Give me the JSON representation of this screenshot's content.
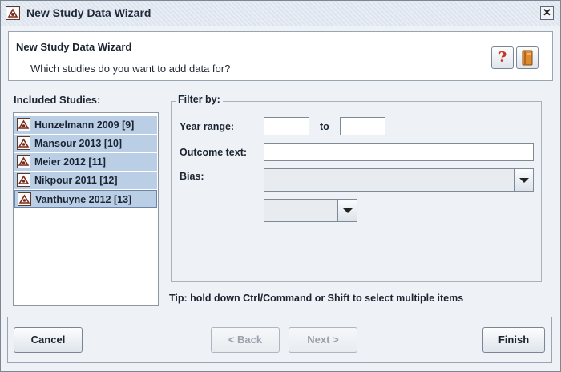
{
  "window": {
    "title": "New Study Data Wizard",
    "icon": "addis-app-icon",
    "close_icon": "close-icon"
  },
  "header": {
    "title": "New Study Data Wizard",
    "subtitle": "Which studies do you want to add data for?",
    "help_label": "?",
    "help_icon": "help-icon",
    "book_icon": "book-icon"
  },
  "studies": {
    "label": "Included Studies:",
    "items": [
      {
        "label": "Hunzelmann 2009 [9]"
      },
      {
        "label": "Mansour 2013 [10]"
      },
      {
        "label": "Meier 2012 [11]"
      },
      {
        "label": "Nikpour 2011 [12]"
      },
      {
        "label": "Vanthuyne 2012 [13]"
      }
    ],
    "selection_color": "#bacee6"
  },
  "filter": {
    "legend": "Filter by:",
    "year_range_label": "Year range:",
    "year_from": "",
    "to_label": "to",
    "year_to": "",
    "outcome_text_label": "Outcome text:",
    "outcome_text": "",
    "bias_label": "Bias:",
    "bias_value": "",
    "bias_sub_value": ""
  },
  "tip": "Tip: hold down Ctrl/Command or Shift to select multiple items",
  "buttons": {
    "cancel": "Cancel",
    "back": "< Back",
    "next": "Next >",
    "finish": "Finish"
  }
}
